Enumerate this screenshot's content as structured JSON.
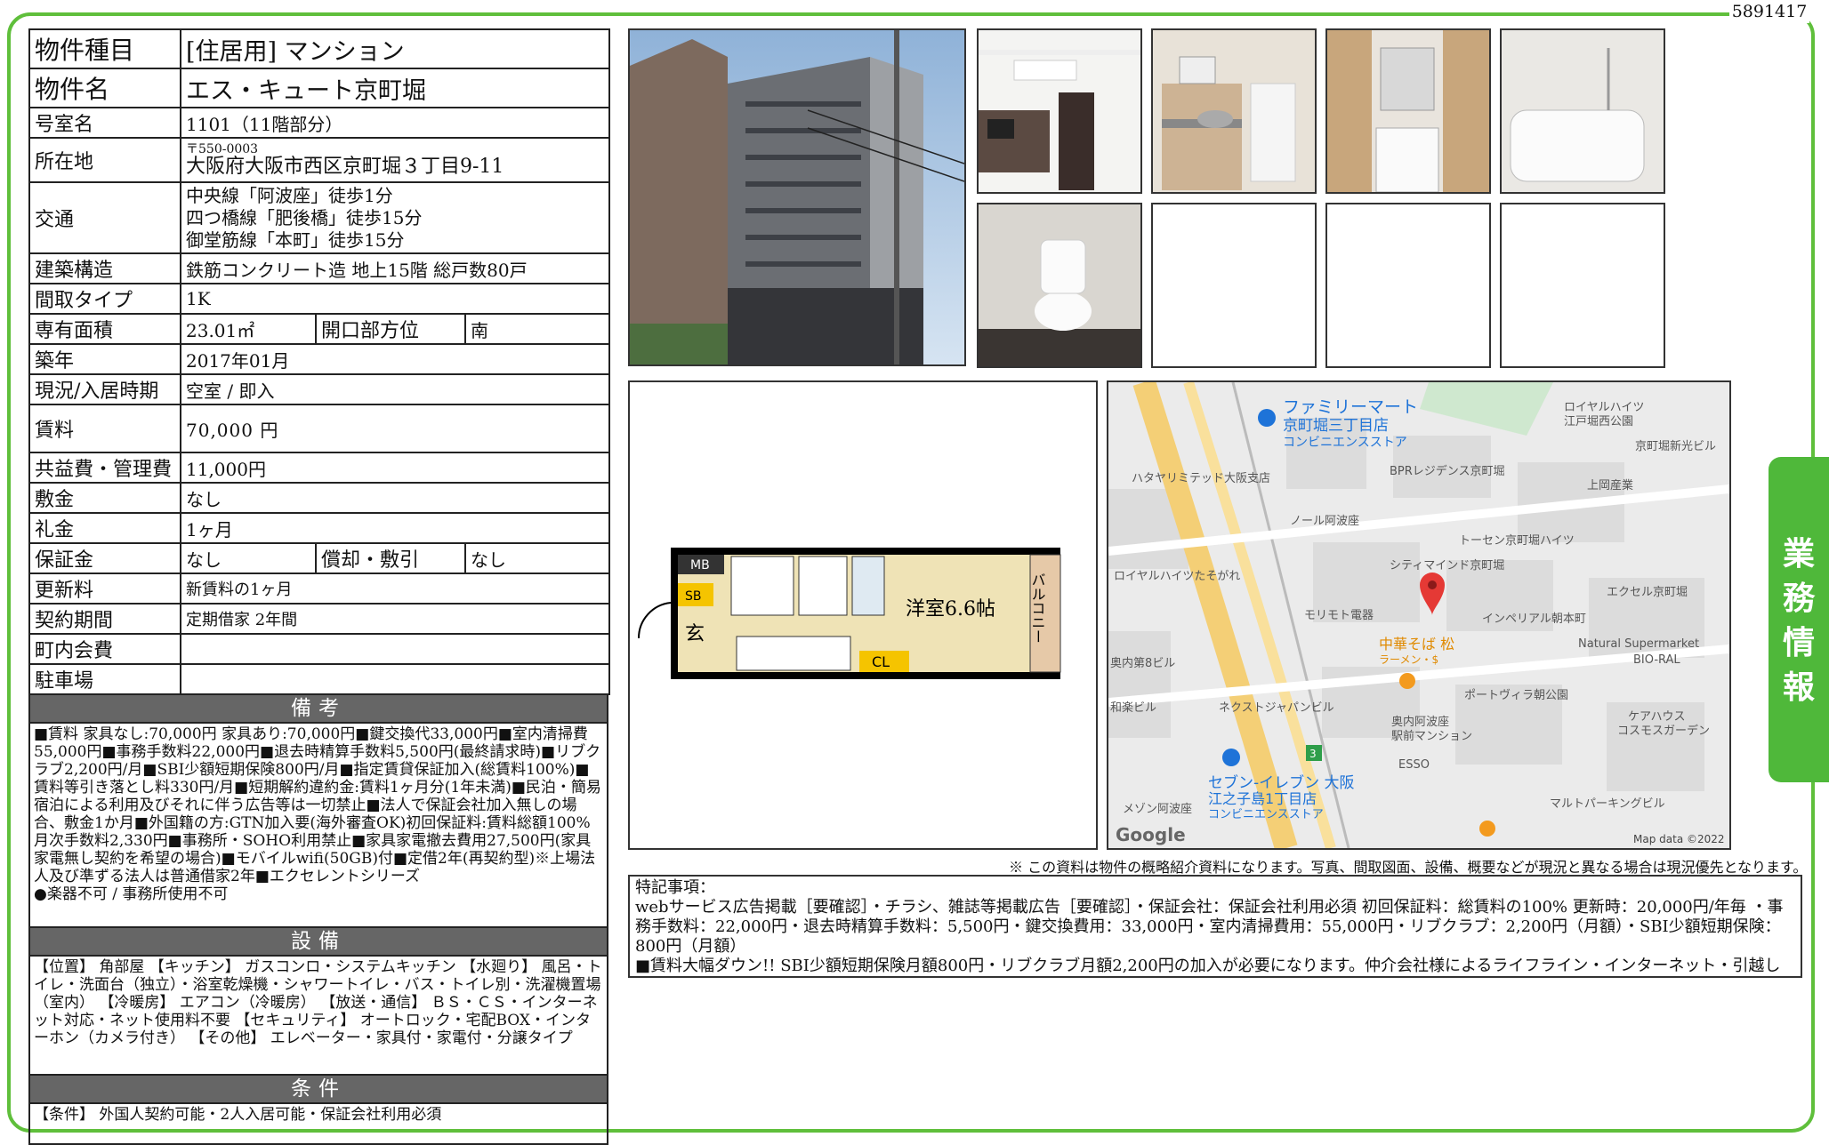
{
  "doc_id": "5891417",
  "side_tab": "業務情報",
  "rows": {
    "type_label": "物件種目",
    "type_value": "[住居用] マンション",
    "name_label": "物件名",
    "name_value": "エス・キュート京町堀",
    "room_label": "号室名",
    "room_value": "1101（11階部分）",
    "addr_label": "所在地",
    "postal": "〒550-0003",
    "address": "大阪府大阪市西区京町堀３丁目9-11",
    "transit_label": "交通",
    "transit_1": "中央線「阿波座」徒歩1分",
    "transit_2": "四つ橋線「肥後橋」徒歩15分",
    "transit_3": "御堂筋線「本町」徒歩15分",
    "structure_label": "建築構造",
    "structure_value": "鉄筋コンクリート造 地上15階 総戸数80戸",
    "layout_label": "間取タイプ",
    "layout_value": "1K",
    "area_label": "専有面積",
    "area_value": "23.01㎡",
    "direction_label": "開口部方位",
    "direction_value": "南",
    "built_label": "築年",
    "built_value": "2017年01月",
    "status_label": "現況/入居時期",
    "status_value": "空室 / 即入",
    "rent_label": "賃料",
    "rent_value": "70,000 円",
    "fee_label": "共益費・管理費",
    "fee_value": "11,000円",
    "deposit_label": "敷金",
    "deposit_value": "なし",
    "keymoney_label": "礼金",
    "keymoney_value": "1ヶ月",
    "guarantee_label": "保証金",
    "guarantee_value": "なし",
    "amort_label": "償却・敷引",
    "amort_value": "なし",
    "renew_label": "更新料",
    "renew_value": "新賃料の1ヶ月",
    "contract_label": "契約期間",
    "contract_value": "定期借家 2年間",
    "town_label": "町内会費",
    "town_value": "",
    "parking_label": "駐車場",
    "parking_value": ""
  },
  "remarks": {
    "heading": "備考",
    "text": "■賃料 家具なし:70,000円 家具あり:70,000円■鍵交換代33,000円■室内清掃費55,000円■事務手数料22,000円■退去時精算手数料5,500円(最終請求時)■リブクラブ2,200円/月■SBI少額短期保険800円/月■指定賃貸保証加入(総賃料100%)■賃料等引き落とし料330円/月■短期解約違約金:賃料1ヶ月分(1年未満)■民泊・簡易宿泊による利用及びそれに伴う広告等は一切禁止■法人で保証会社加入無しの場合、敷金1か月■外国籍の方:GTN加入要(海外審査OK)初回保証料:賃料総額100% 月次手数料2,330円■事務所・SOHO利用禁止■家具家電撤去費用27,500円(家具家電無し契約を希望の場合)■モバイルwifi(50GB)付■定借2年(再契約型)※上場法人及び準ずる法人は普通借家2年■エクセレントシリーズ",
    "note": "●楽器不可 / 事務所使用不可"
  },
  "equipment": {
    "heading": "設備",
    "text": "【位置】 角部屋 【キッチン】 ガスコンロ・システムキッチン 【水廻り】 風呂・トイレ・洗面台（独立）・浴室乾燥機・シャワートイレ・バス・トイレ別・洗濯機置場（室内） 【冷暖房】 エアコン（冷暖房） 【放送・通信】 ＢＳ・ＣＳ・インターネット対応・ネット使用料不要 【セキュリティ】 オートロック・宅配BOX・インターホン（カメラ付き） 【その他】 エレベーター・家具付・家電付・分譲タイプ"
  },
  "conditions": {
    "heading": "条件",
    "text": "【条件】 外国人契約可能・2人入居可能・保証会社利用必須"
  },
  "floorplan": {
    "mb": "MB",
    "sb": "SB",
    "genkan": "玄",
    "room": "洋室6.6帖",
    "cl": "CL",
    "balcony": "バルコニー"
  },
  "map": {
    "labels": [
      "ファミリーマート",
      "京町堀三丁目店",
      "コンビニエンスストア",
      "ロイヤルハイツ",
      "江戸堀西公園",
      "京町堀新光ビル",
      "ハタヤリミテッド大阪支店",
      "BPRレジデンス京町堀",
      "上岡産業",
      "ノール阿波座",
      "トーセン京町堀ハイツ",
      "ロイヤルハイツたそがれ",
      "シティマインド京町堀",
      "エクセル京町堀",
      "モリモト電器",
      "インペリアル朝本町",
      "Natural Supermarket",
      "BIO-RAL",
      "奥内第8ビル",
      "中華そば 松",
      "ラーメン・$",
      "ポートヴィラ朝公園",
      "和楽ビル",
      "ネクストジャパンビル",
      "奥内阿波座",
      "駅前マンション",
      "ケアハウス",
      "コスモスガーデン",
      "セブン-イレブン 大阪",
      "江之子島1丁目店",
      "コンビニエンスストア",
      "ESSO",
      "メゾン阿波座",
      "マルトパーキングビル",
      "3"
    ],
    "google": "Google",
    "credit": "Map data ©2022"
  },
  "disclaimer": "※ この資料は物件の概略紹介資料になります。写真、間取図面、設備、概要などが現況と異なる場合は現況優先となります。",
  "notes": {
    "title": "特記事項：",
    "line1": "webサービス広告掲載［要確認］・チラシ、雑誌等掲載広告［要確認］・保証会社：保証会社利用必須 初回保証料：総賃料の100% 更新時：20,000円/年毎 ・事務手数料：22,000円・退去時精算手数料：5,500円・鍵交換費用：33,000円・室内清掃費用：55,000円・リブクラブ：2,200円（月額）・SBI少額短期保険：800円（月額）",
    "line2": "■賃料大幅ダウン!! SBI少額短期保険月額800円・リブクラブ月額2,200円の加入が必要になります。仲介会社様によるライフライン・インターネット・引越しの取次は【不可】となります。"
  }
}
